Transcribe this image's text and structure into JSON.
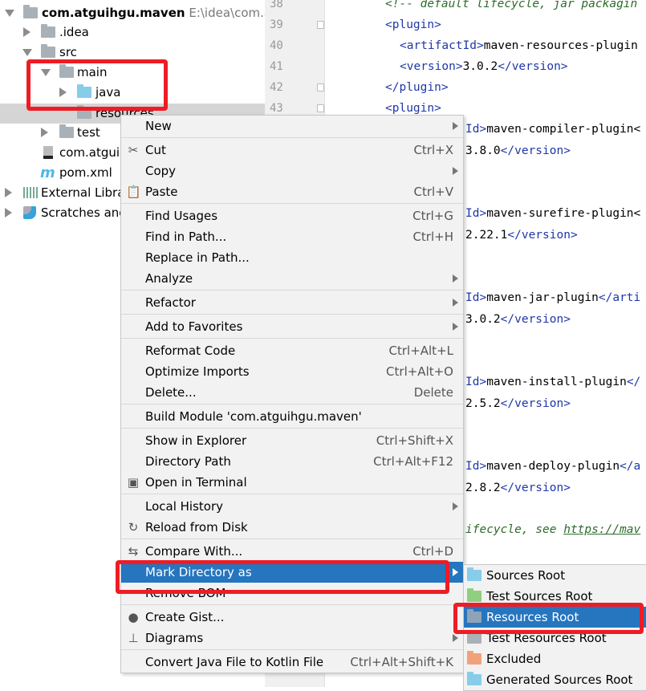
{
  "tree": {
    "project": {
      "name": "com.atguihgu.maven",
      "path": "E:\\idea\\com.atg"
    },
    "items": [
      {
        "label": ".idea"
      },
      {
        "label": "src"
      },
      {
        "label": "main"
      },
      {
        "label": "java"
      },
      {
        "label": "resources"
      },
      {
        "label": "test"
      },
      {
        "label": "com.atguil"
      },
      {
        "label": "pom.xml"
      },
      {
        "label": "External Libra"
      },
      {
        "label": "Scratches and"
      }
    ]
  },
  "editor": {
    "line_numbers": [
      "38",
      "39",
      "40",
      "41",
      "42",
      "43"
    ],
    "lines": [
      {
        "t1": "<!-- default lifecycle, jar packagin"
      },
      {
        "t1": "<plugin>"
      },
      {
        "t1": "<artifactId>",
        "t2": "maven-resources-plugin"
      },
      {
        "t1": "<version>",
        "t2": "3.0.2",
        "t3": "</version>"
      },
      {
        "t1": "</plugin>"
      },
      {
        "t1": "<plugin>"
      }
    ],
    "fragments": [
      {
        "a": "Id>",
        "b": "maven-compiler-plugin<"
      },
      {
        "a": "",
        "b": "3.8.0",
        "c": "</version>"
      },
      {
        "a": "Id>",
        "b": "maven-surefire-plugin<"
      },
      {
        "a": "",
        "b": "2.22.1",
        "c": "</version>"
      },
      {
        "a": "Id>",
        "b": "maven-jar-plugin",
        "c": "</arti"
      },
      {
        "a": "",
        "b": "3.0.2",
        "c": "</version>"
      },
      {
        "a": "Id>",
        "b": "maven-install-plugin",
        "c": "</"
      },
      {
        "a": "",
        "b": "2.5.2",
        "c": "</version>"
      },
      {
        "a": "Id>",
        "b": "maven-deploy-plugin",
        "c": "</a"
      },
      {
        "a": "",
        "b": "2.8.2",
        "c": "</version>"
      }
    ],
    "comment_fragment": "ifecycle, see ",
    "comment_link": "https://mav"
  },
  "context_menu": {
    "groups": [
      [
        {
          "label": "New",
          "submenu": true
        }
      ],
      [
        {
          "label": "Cut",
          "shortcut": "Ctrl+X",
          "icon": "scissors-icon"
        },
        {
          "label": "Copy",
          "submenu": true
        },
        {
          "label": "Paste",
          "shortcut": "Ctrl+V",
          "icon": "clipboard-icon"
        }
      ],
      [
        {
          "label": "Find Usages",
          "shortcut": "Ctrl+G"
        },
        {
          "label": "Find in Path...",
          "shortcut": "Ctrl+H"
        },
        {
          "label": "Replace in Path..."
        },
        {
          "label": "Analyze",
          "submenu": true
        }
      ],
      [
        {
          "label": "Refactor",
          "submenu": true
        }
      ],
      [
        {
          "label": "Add to Favorites",
          "submenu": true
        }
      ],
      [
        {
          "label": "Reformat Code",
          "shortcut": "Ctrl+Alt+L"
        },
        {
          "label": "Optimize Imports",
          "shortcut": "Ctrl+Alt+O"
        },
        {
          "label": "Delete...",
          "shortcut": "Delete"
        }
      ],
      [
        {
          "label": "Build Module 'com.atguihgu.maven'"
        }
      ],
      [
        {
          "label": "Show in Explorer",
          "shortcut": "Ctrl+Shift+X"
        },
        {
          "label": "Directory Path",
          "shortcut": "Ctrl+Alt+F12"
        },
        {
          "label": "Open in Terminal",
          "icon": "terminal-icon"
        }
      ],
      [
        {
          "label": "Local History",
          "submenu": true
        },
        {
          "label": "Reload from Disk",
          "icon": "reload-icon"
        }
      ],
      [
        {
          "label": "Compare With...",
          "shortcut": "Ctrl+D",
          "icon": "compare-icon"
        },
        {
          "label": "Mark Directory as",
          "submenu": true,
          "highlighted": true
        },
        {
          "label": "Remove BOM"
        }
      ],
      [
        {
          "label": "Create Gist...",
          "icon": "github-icon"
        },
        {
          "label": "Diagrams",
          "submenu": true,
          "icon": "diagram-icon"
        }
      ],
      [
        {
          "label": "Convert Java File to Kotlin File",
          "shortcut": "Ctrl+Alt+Shift+K"
        }
      ]
    ]
  },
  "submenu": {
    "items": [
      {
        "label": "Sources Root",
        "color": "#87cdea"
      },
      {
        "label": "Test Sources Root",
        "color": "#8fcf7f"
      },
      {
        "label": "Resources Root",
        "color": "#8fa3b8",
        "highlighted": true
      },
      {
        "label": "Test Resources Root",
        "color": "#a9b1b8"
      },
      {
        "label": "Excluded",
        "color": "#f2a27a"
      },
      {
        "label": "Generated Sources Root",
        "color": "#87cdea"
      }
    ]
  },
  "colors": {
    "highlight": "#2675bf",
    "annotation": "#ee1c25"
  }
}
